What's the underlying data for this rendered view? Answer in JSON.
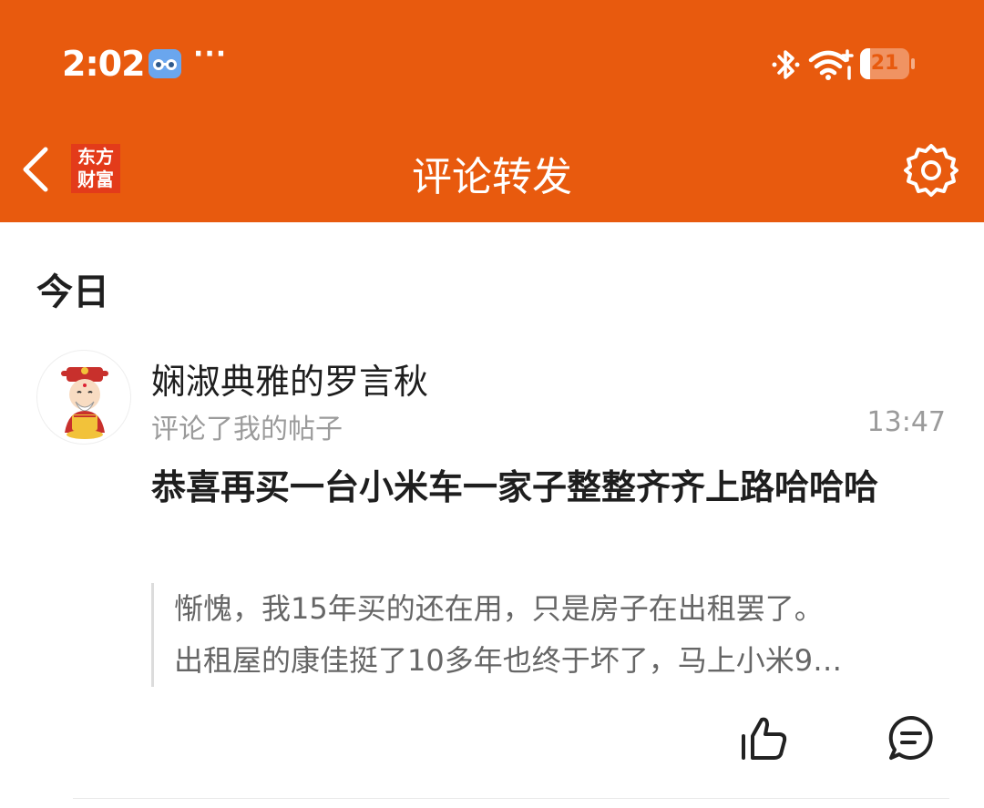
{
  "status_bar": {
    "time": "2:02",
    "more": "···",
    "battery_level": "21",
    "battery_fraction": 0.21,
    "icons": [
      "glasses-app-icon",
      "bluetooth-icon",
      "wifi-icon",
      "battery-icon"
    ]
  },
  "nav": {
    "logo_line1": "东方",
    "logo_line2": "财富",
    "title": "评论转发",
    "icons": [
      "back-arrow-icon",
      "gear-icon"
    ]
  },
  "section": {
    "title": "今日"
  },
  "notification": {
    "username": "娴淑典雅的罗言秋",
    "action": "评论了我的帖子",
    "time": "13:47",
    "comment": "恭喜再买一台小米车一家子整整齐齐上路哈哈哈",
    "quote_line1": "惭愧，我15年买的还在用，只是房子在出租罢了。",
    "quote_line2": "出租屋的康佳挺了10多年也终于坏了，马上小米9…",
    "icons": [
      "avatar",
      "thumbs-up-icon",
      "comment-icon"
    ]
  },
  "colors": {
    "brand": "#e85a0e",
    "logo_bg": "#e33b1a",
    "text_primary": "#1e1e1e",
    "text_secondary": "#9b9b9b",
    "quote_text": "#666666"
  }
}
